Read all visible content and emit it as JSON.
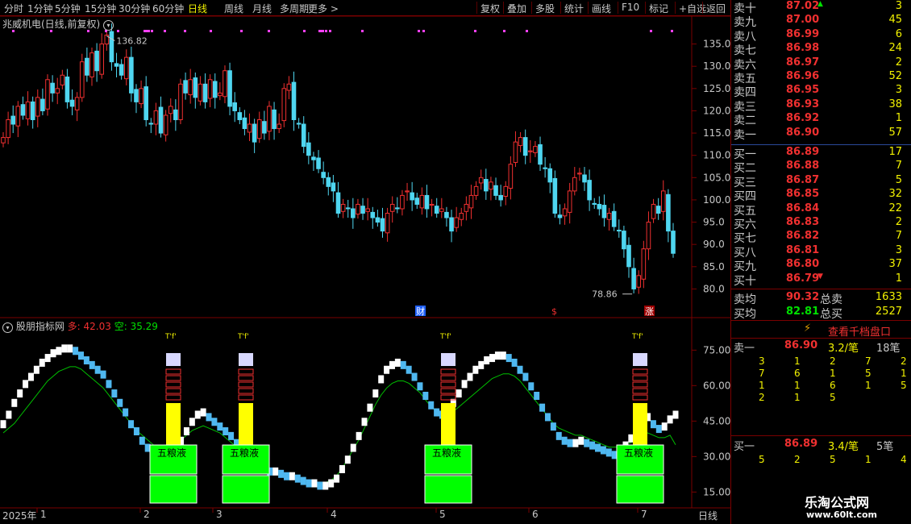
{
  "toolbar": {
    "periods": [
      "分时",
      "1分钟",
      "5分钟",
      "15分钟",
      "30分钟",
      "60分钟",
      "日线",
      "周线",
      "月线",
      "多周期",
      "更多 >"
    ],
    "active": "日线",
    "actions": [
      "复权",
      "叠加",
      "多股",
      "统计",
      "画线",
      "F10",
      "标记",
      "+自选",
      "返回"
    ]
  },
  "title": "兆威机电(日线,前复权)",
  "indicator_title": "股朋指标网",
  "indicator_duo": "多: 42.03",
  "indicator_kong": "空: 35.29",
  "signal_label": "五粮液",
  "signal_marker": "T'f'",
  "annotations": {
    "high": "136.82",
    "low": "78.86",
    "cai": "财",
    "dollar": "$",
    "zhang": "涨"
  },
  "period_label": "日线",
  "timeline": {
    "year": "2025年",
    "months": [
      "1",
      "2",
      "3",
      "4",
      "5",
      "6",
      "7"
    ]
  },
  "colors": {
    "bull": "#f03030",
    "bear": "#4fd6f0",
    "bg": "#000000",
    "border": "#7a0000"
  },
  "order_book": {
    "asks": [
      {
        "label": "卖十",
        "price": "87.02",
        "vol": "3"
      },
      {
        "label": "卖九",
        "price": "87.00",
        "vol": "45"
      },
      {
        "label": "卖八",
        "price": "86.99",
        "vol": "6"
      },
      {
        "label": "卖七",
        "price": "86.98",
        "vol": "24"
      },
      {
        "label": "卖六",
        "price": "86.97",
        "vol": "2"
      },
      {
        "label": "卖五",
        "price": "86.96",
        "vol": "52"
      },
      {
        "label": "卖四",
        "price": "86.95",
        "vol": "3"
      },
      {
        "label": "卖三",
        "price": "86.93",
        "vol": "38"
      },
      {
        "label": "卖二",
        "price": "86.92",
        "vol": "1"
      },
      {
        "label": "卖一",
        "price": "86.90",
        "vol": "57"
      }
    ],
    "bids": [
      {
        "label": "买一",
        "price": "86.89",
        "vol": "17"
      },
      {
        "label": "买二",
        "price": "86.88",
        "vol": "7"
      },
      {
        "label": "买三",
        "price": "86.87",
        "vol": "5"
      },
      {
        "label": "买四",
        "price": "86.85",
        "vol": "32"
      },
      {
        "label": "买五",
        "price": "86.84",
        "vol": "22"
      },
      {
        "label": "买六",
        "price": "86.83",
        "vol": "2"
      },
      {
        "label": "买七",
        "price": "86.82",
        "vol": "7"
      },
      {
        "label": "买八",
        "price": "86.81",
        "vol": "3"
      },
      {
        "label": "买九",
        "price": "86.80",
        "vol": "37"
      },
      {
        "label": "买十",
        "price": "86.79",
        "vol": "1"
      }
    ],
    "avg_sell": {
      "label": "卖均",
      "price": "90.32",
      "total_label": "总卖",
      "total": "1633"
    },
    "avg_buy": {
      "label": "买均",
      "price": "82.81",
      "total_label": "总买",
      "total": "2527"
    }
  },
  "thousand_view": "查看千档盘口",
  "queue": {
    "sell": {
      "label": "卖一",
      "price": "86.90",
      "per": "3.2/笔",
      "count": "18笔",
      "grid": [
        [
          "3",
          "1",
          "2",
          "7",
          "2"
        ],
        [
          "7",
          "6",
          "1",
          "5",
          "1"
        ],
        [
          "1",
          "1",
          "6",
          "1",
          "5"
        ],
        [
          "2",
          "1",
          "5",
          "",
          ""
        ]
      ]
    },
    "buy": {
      "label": "买一",
      "price": "86.89",
      "per": "3.4/笔",
      "count": "5笔",
      "grid": [
        [
          "5",
          "2",
          "5",
          "1",
          "4"
        ]
      ]
    }
  },
  "watermark": {
    "name": "乐淘公式网",
    "url": "www.60lt.com"
  },
  "chart_data": [
    {
      "type": "candlestick",
      "title": "兆威机电(日线,前复权)",
      "y_ticks": [
        "135.0",
        "130.0",
        "125.0",
        "120.0",
        "115.0",
        "110.0",
        "105.0",
        "100.0",
        "95.0",
        "90.0",
        "85.0",
        "80.0"
      ],
      "ylim": [
        77,
        138
      ],
      "high_mark": 136.82,
      "low_mark": 78.86,
      "close": [
        114,
        118,
        117,
        121,
        119,
        122,
        118,
        123,
        120,
        127,
        124,
        125,
        128,
        122,
        121,
        123,
        131,
        128,
        133,
        129,
        135,
        137,
        131,
        130,
        128,
        132,
        124,
        122,
        125,
        118,
        117,
        120,
        115,
        119,
        121,
        118,
        126,
        124,
        127,
        123,
        126,
        122,
        127,
        123,
        124,
        129,
        121,
        120,
        118,
        116,
        117,
        113,
        118,
        115,
        121,
        116,
        117,
        125,
        126,
        118,
        117,
        112,
        110,
        109,
        107,
        105,
        103,
        102,
        97,
        99,
        98,
        96,
        99,
        97,
        98,
        96,
        95,
        93,
        97,
        99,
        98,
        101,
        102,
        100,
        99,
        101,
        98,
        99,
        97,
        98,
        96,
        93,
        96,
        97,
        99,
        101,
        103,
        105,
        102,
        104,
        101,
        100,
        103,
        108,
        113,
        114,
        110,
        111,
        112,
        108,
        107,
        104,
        97,
        96,
        98,
        102,
        105,
        106,
        104,
        100,
        99,
        98,
        96,
        97,
        94,
        93,
        89,
        85,
        80,
        83,
        89,
        95,
        99,
        97,
        102,
        93,
        88
      ],
      "series_note": ""
    },
    {
      "type": "line",
      "title": "股朋指标网",
      "y_ticks": [
        "75.00",
        "60.00",
        "45.00",
        "30.00",
        "15.00"
      ],
      "ylim": [
        10,
        85
      ],
      "series": [
        {
          "name": "多",
          "last": 42.03
        },
        {
          "name": "空",
          "last": 35.29
        }
      ],
      "duo": [
        43,
        47,
        52,
        56,
        60,
        63,
        66,
        69,
        71,
        73,
        74,
        75,
        75,
        74,
        72,
        70,
        68,
        66,
        64,
        60,
        56,
        52,
        48,
        43,
        40,
        36,
        33,
        31,
        30,
        30,
        31,
        33,
        36,
        40,
        44,
        47,
        48,
        46,
        44,
        42,
        40,
        38,
        35,
        32,
        29,
        27,
        25,
        24,
        23,
        23,
        22,
        21,
        21,
        20,
        19,
        18,
        18,
        17,
        17,
        18,
        20,
        24,
        28,
        33,
        38,
        44,
        50,
        56,
        62,
        66,
        68,
        69,
        68,
        66,
        63,
        59,
        55,
        51,
        48,
        47,
        49,
        52,
        56,
        60,
        63,
        66,
        68,
        70,
        71,
        72,
        72,
        71,
        69,
        66,
        63,
        59,
        55,
        50,
        46,
        42,
        38,
        36,
        35,
        35,
        36,
        35,
        34,
        33,
        32,
        31,
        30,
        31,
        34,
        37,
        40,
        44,
        46,
        43,
        41,
        42,
        45,
        47
      ],
      "kong": [
        40,
        42,
        44,
        47,
        50,
        53,
        56,
        59,
        62,
        64,
        66,
        67,
        68,
        68,
        67,
        65,
        63,
        61,
        59,
        56,
        53,
        50,
        47,
        44,
        41,
        39,
        37,
        35,
        34,
        34,
        35,
        36,
        37,
        39,
        41,
        42,
        43,
        42,
        41,
        40,
        38,
        36,
        34,
        32,
        30,
        28,
        27,
        26,
        25,
        24,
        23,
        22,
        22,
        21,
        20,
        20,
        19,
        19,
        19,
        20,
        22,
        25,
        29,
        33,
        37,
        42,
        47,
        52,
        56,
        59,
        61,
        62,
        62,
        61,
        59,
        57,
        54,
        51,
        49,
        48,
        48,
        49,
        51,
        53,
        55,
        57,
        59,
        61,
        63,
        64,
        65,
        65,
        64,
        62,
        59,
        56,
        53,
        50,
        47,
        44,
        42,
        41,
        40,
        39,
        39,
        38,
        37,
        36,
        35,
        34,
        34,
        34,
        35,
        36,
        37,
        39,
        40,
        39,
        38,
        38,
        39,
        35
      ]
    }
  ]
}
